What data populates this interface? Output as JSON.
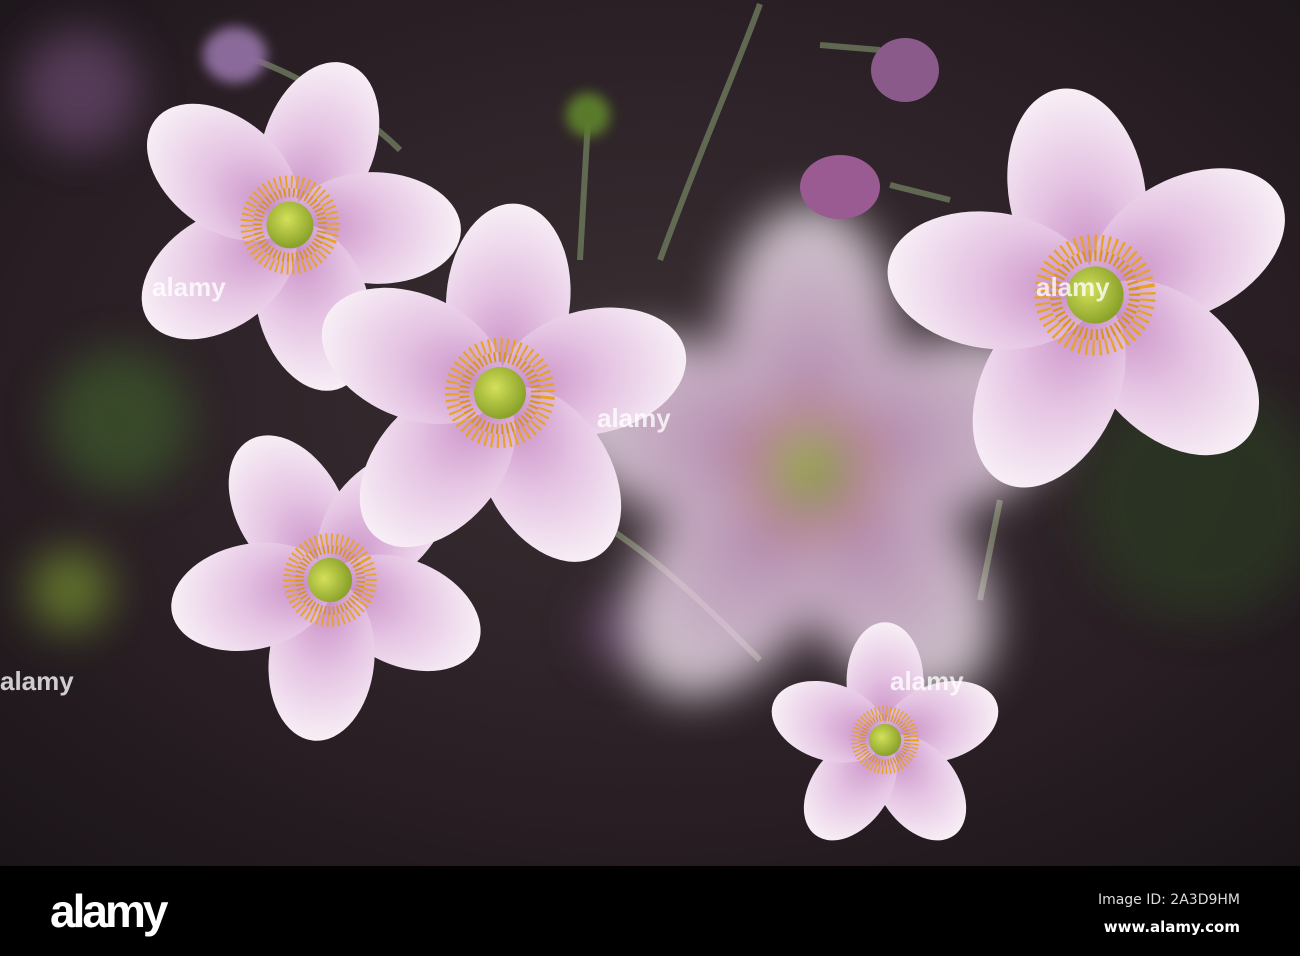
{
  "watermark": {
    "brand": "alamy",
    "image_id": "Image ID: 2A3D9HM",
    "website": "www.alamy.com"
  },
  "colors": {
    "background": "#2a1d22",
    "petal": "#f3e6f0",
    "petal_pink": "#d9a6d2",
    "center": "#a9c43a",
    "stamen": "#e8a326"
  }
}
